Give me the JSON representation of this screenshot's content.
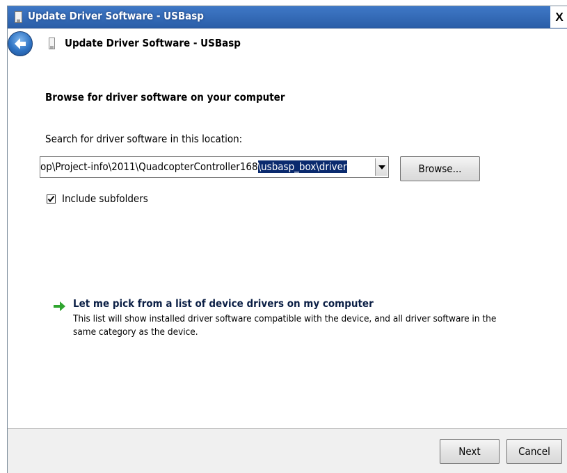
{
  "window": {
    "title": "Update Driver Software - USBasp",
    "close_label": "X"
  },
  "navbar": {
    "title": "Update Driver Software - USBasp"
  },
  "page": {
    "heading": "Browse for driver software on your computer",
    "search_label": "Search for driver software in this location:",
    "path": {
      "unselected": "op\\Project-info\\2011\\QuadcopterController168",
      "selected": "\\usbasp_box\\driver"
    },
    "browse_label": "Browse...",
    "include_subfolders": {
      "label": "Include subfolders",
      "checked": true
    },
    "pick": {
      "title": "Let me pick from a list of device drivers on my computer",
      "description": "This list will show installed driver software compatible with the device, and all driver software in the same category as the device."
    }
  },
  "footer": {
    "next_label": "Next",
    "cancel_label": "Cancel"
  },
  "icons": {
    "back": "back-arrow-icon",
    "device": "usb-device-icon",
    "pick": "green-arrow-icon",
    "dropdown": "chevron-down-icon"
  },
  "colors": {
    "titlebar": "#2f66b3",
    "selection": "#0a2a6e",
    "link_arrow": "#2fa52f"
  }
}
